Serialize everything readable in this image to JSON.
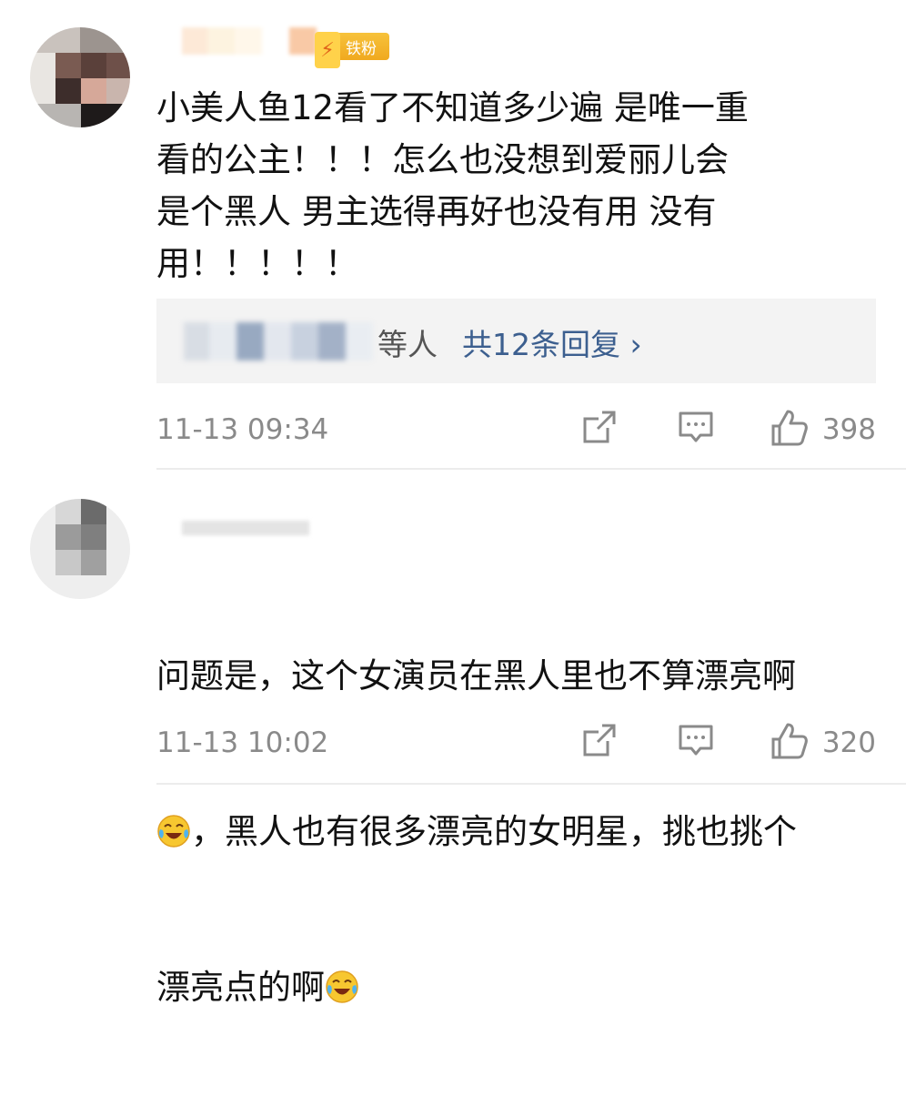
{
  "comments": [
    {
      "badge": {
        "label": "铁粉",
        "icon": "fan-badge-icon"
      },
      "text": "小美人鱼12看了不知道多少遍 是唯一重\n看的公主！！！怎么也没想到爱丽儿会\n是个黑人 男主选得再好也没有用 没有\n用！！！！！",
      "reply_summary": {
        "suffix": "等人",
        "link": "共12条回复 ›"
      },
      "timestamp": "11-13 09:34",
      "likes": "398"
    },
    {
      "text_lines": [
        "问题是，这个女演员在黑人里也不算漂亮啊",
        "，黑人也有很多漂亮的女明星，挑也挑个",
        "漂亮点的啊"
      ],
      "timestamp": "11-13 10:02",
      "likes": "320"
    }
  ],
  "icons": {
    "share": "share-icon",
    "comment": "comment-icon",
    "like": "thumbs-up-icon",
    "emoji": "laugh-cry-emoji-icon"
  },
  "colors": {
    "link": "#3c5f8f",
    "meta": "#8a8a8a",
    "badge": "#f0a91f"
  }
}
